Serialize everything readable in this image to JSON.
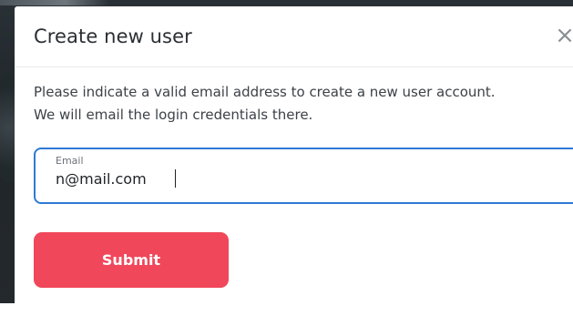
{
  "modal": {
    "title": "Create new user",
    "close_glyph": "×",
    "description_line1": "Please indicate a valid email address to create a new user account.",
    "description_line2": "We will email the login credentials there.",
    "email_field": {
      "label": "Email",
      "value": "n@mail.com",
      "type": "email"
    },
    "submit_label": "Submit"
  },
  "colors": {
    "accent_red": "#f0475a",
    "focus_blue": "#2f79d6",
    "title_text": "#2b2f33",
    "body_text": "#3c4248"
  },
  "icons": {
    "close": "close-icon"
  }
}
